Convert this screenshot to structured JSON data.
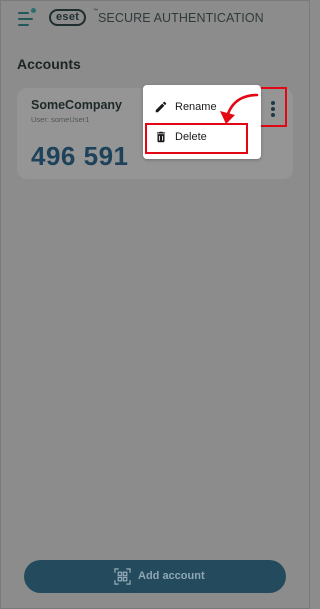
{
  "header": {
    "brand_logo": "eset",
    "brand_tm": "™",
    "title": "SECURE AUTHENTICATION",
    "menu_icon": "hamburger-menu-icon"
  },
  "section": {
    "title": "Accounts"
  },
  "account": {
    "name": "SomeCompany",
    "user": "User: someUser1",
    "code": "496 591",
    "more_icon": "more-vertical-icon"
  },
  "context_menu": {
    "items": [
      {
        "label": "Rename",
        "icon": "pencil-icon"
      },
      {
        "label": "Delete",
        "icon": "trash-icon"
      }
    ]
  },
  "footer": {
    "add_account_label": "Add account",
    "add_account_icon": "qr-scan-icon"
  },
  "colors": {
    "overlay_background": "#8c8c8c",
    "highlight_red": "#e30613",
    "button_background": "#244a5d",
    "code_color": "#1e4259"
  }
}
